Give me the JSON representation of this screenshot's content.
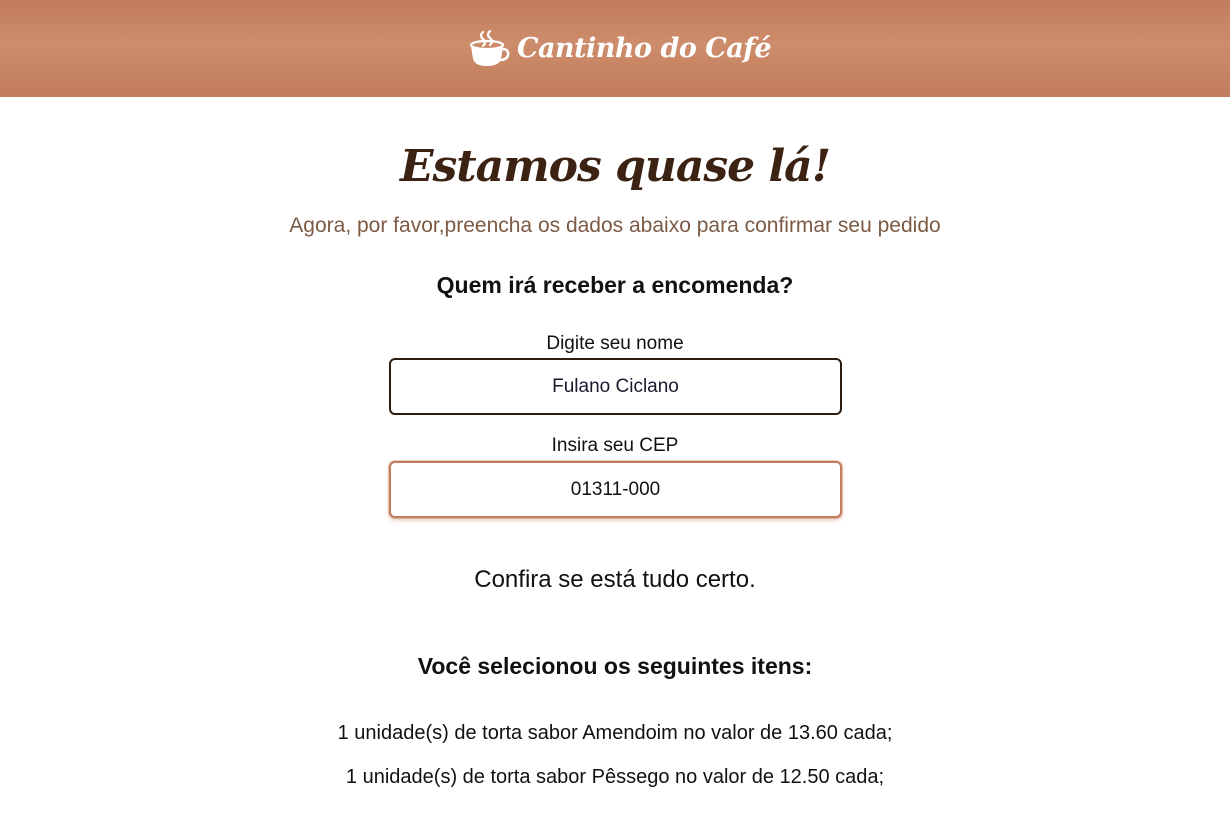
{
  "header": {
    "brand_name": "Cantinho do Café",
    "brand_icon": "coffee-cup-icon",
    "background_color": "#c17d5c"
  },
  "hero": {
    "title": "Estamos quase lá!",
    "subtitle": "Agora, por favor,preencha os dados abaixo para confirmar seu pedido"
  },
  "form": {
    "heading": "Quem irá receber a encomenda?",
    "name_label": "Digite seu nome",
    "name_value": "Fulano Ciclano",
    "cep_label": "Insira seu CEP",
    "cep_value": "01311-000"
  },
  "summary": {
    "confirm_text": "Confira se está tudo certo.",
    "items_heading": "Você selecionou os seguintes itens:",
    "items": [
      "1 unidade(s) de torta sabor Amendoim no valor de 13.60 cada;",
      "1 unidade(s) de torta sabor Pêssego no valor de 12.50 cada;"
    ]
  },
  "colors": {
    "accent": "#c17d5c",
    "title": "#3b2212",
    "subtitle": "#7c5a43"
  }
}
